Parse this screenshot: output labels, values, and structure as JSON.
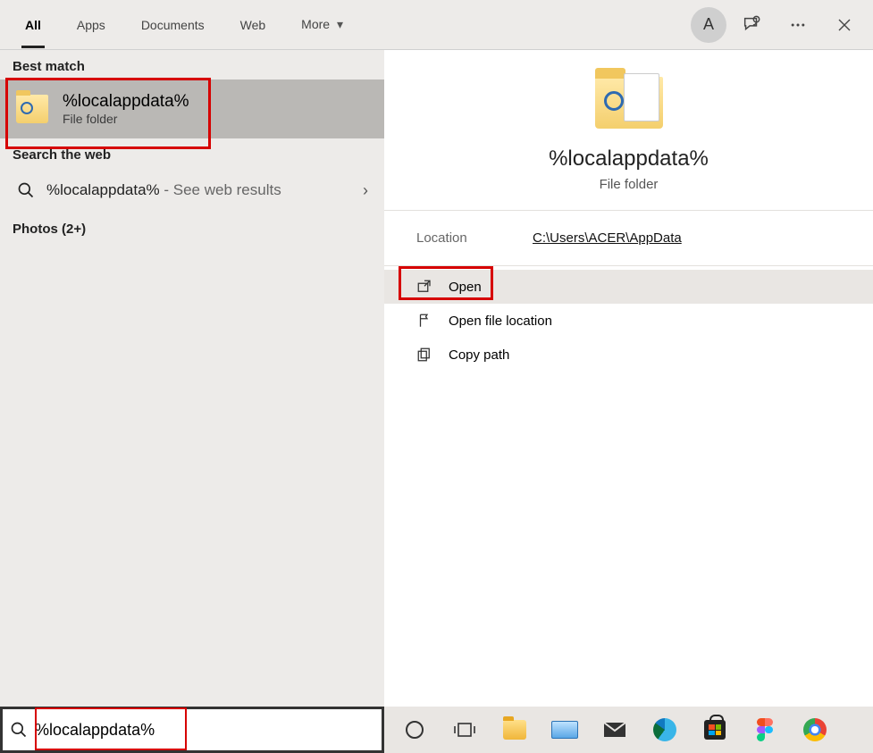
{
  "topbar": {
    "tabs": {
      "all": "All",
      "apps": "Apps",
      "documents": "Documents",
      "web": "Web",
      "more": "More"
    },
    "avatar_initial": "A"
  },
  "left": {
    "best_match_header": "Best match",
    "best_match": {
      "title": "%localappdata%",
      "subtitle": "File folder"
    },
    "search_web_header": "Search the web",
    "web_item": {
      "query": "%localappdata%",
      "suffix": " - See web results"
    },
    "photos_header": "Photos (2+)"
  },
  "right": {
    "title": "%localappdata%",
    "subtitle": "File folder",
    "location_label": "Location",
    "location_value": "C:\\Users\\ACER\\AppData",
    "actions": {
      "open": "Open",
      "open_location": "Open file location",
      "copy_path": "Copy path"
    }
  },
  "search": {
    "value": "%localappdata%"
  }
}
